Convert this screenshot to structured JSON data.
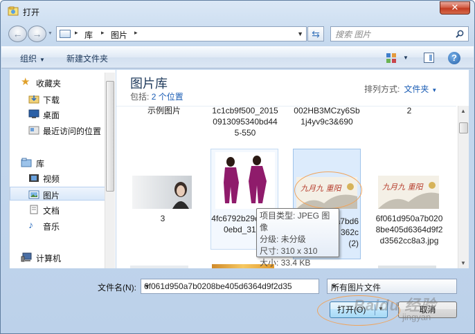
{
  "window": {
    "title": "打开",
    "close_glyph": "✕"
  },
  "address": {
    "breadcrumbs": [
      "库",
      "图片"
    ],
    "separator": "▸",
    "search_placeholder": "搜索 图片"
  },
  "toolbar": {
    "organize_label": "组织",
    "new_folder_label": "新建文件夹",
    "help_glyph": "?"
  },
  "nav": {
    "favorites_label": "收藏夹",
    "download_label": "下载",
    "desktop_label": "桌面",
    "recent_label": "最近访问的位置",
    "libraries_label": "库",
    "videos_label": "视频",
    "pictures_label": "图片",
    "documents_label": "文档",
    "music_label": "音乐",
    "computer_label": "计算机"
  },
  "library": {
    "title": "图片库",
    "includes_prefix": "包括:",
    "includes_link": "2 个位置",
    "arrange_label": "排列方式:",
    "arrange_value": "文件夹"
  },
  "tiles": {
    "sample_pictures": "示例图片",
    "file_1c1": "1c1cb9f500_20150913095340bd445-550",
    "file_002": "002HB3MCzy6Sb1j4yv9c3&690",
    "file_2": "2",
    "file_3": "3",
    "file_4fc": "4fc6792b29ce3680ebd_310_",
    "file_sel_partial": "a7bd6362c(2)",
    "file_6f0": "6f061d950a7b0208be405d6364d9f2d3562cc8a3.jpg"
  },
  "tooltip": {
    "type_line": "项目类型: JPEG 图像",
    "rating_line": "分级: 未分级",
    "dimensions_line": "尺寸: 310 x 310",
    "size_line": "大小: 33.4 KB"
  },
  "bottom": {
    "filename_label": "文件名(N):",
    "filename_value": "6f061d950a7b0208be405d6364d9f2d35",
    "filter_value": "所有图片文件",
    "open_label": "打开(O)",
    "cancel_label": "取消",
    "watermark": "Baidu 经验",
    "watermark_sub": "jingyan"
  },
  "colors": {
    "accent": "#1a5cb4",
    "selection": "#dcebfc",
    "highlight_oval": "#f0a35a"
  }
}
